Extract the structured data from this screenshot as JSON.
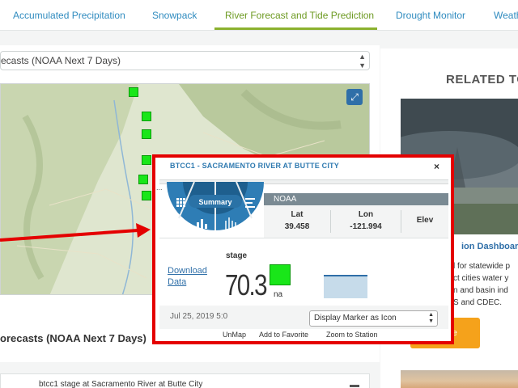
{
  "nav": {
    "tabs": [
      {
        "label": "Accumulated Precipitation"
      },
      {
        "label": "Snowpack"
      },
      {
        "label": "River Forecast and Tide Prediction",
        "active": true
      },
      {
        "label": "Drought Monitor"
      },
      {
        "label": "Weath"
      }
    ]
  },
  "left": {
    "select_value": "ecasts (NOAA Next 7 Days)",
    "section_title": "orecasts (NOAA Next 7 Days)",
    "lower_item": "btcc1 stage at Sacramento River at Butte City"
  },
  "popup": {
    "title": "BTCC1 - SACRAMENTO RIVER AT BUTTE CITY",
    "close": "×",
    "ellipsis": "...",
    "summary_label": "Summary",
    "agency": "NOAA",
    "lat_label": "Lat",
    "lat_value": "39.458",
    "lon_label": "Lon",
    "lon_value": "-121.994",
    "elev_label": "Elev",
    "download_label_1": "Download",
    "download_label_2": "Data",
    "stage_label": "stage",
    "stage_value": "70.3",
    "stage_unit": "na",
    "date": "Jul 25, 2019 5:0",
    "marker_option": "Display Marker as Icon",
    "links": [
      "UnMap",
      "Add to Favorite",
      "Zoom to Station"
    ]
  },
  "right": {
    "related_title": "RELATED TO",
    "dashboard_link": "ion Dashboard",
    "dashboard_lines": [
      "l for statewide p",
      "ct cities water y",
      "n and basin ind",
      "S and CDEC."
    ],
    "more_button": "ore"
  },
  "colors": {
    "accent": "#2f8bbf",
    "active_tab": "#6d9a22",
    "marker": "#19e619",
    "highlight": "#e40000",
    "button": "#f5a21b"
  },
  "icons": [
    "expand-icon",
    "grid-icon",
    "bar-chart-icon",
    "list-icon",
    "waveform-icon",
    "close-icon",
    "select-arrows-icon"
  ]
}
